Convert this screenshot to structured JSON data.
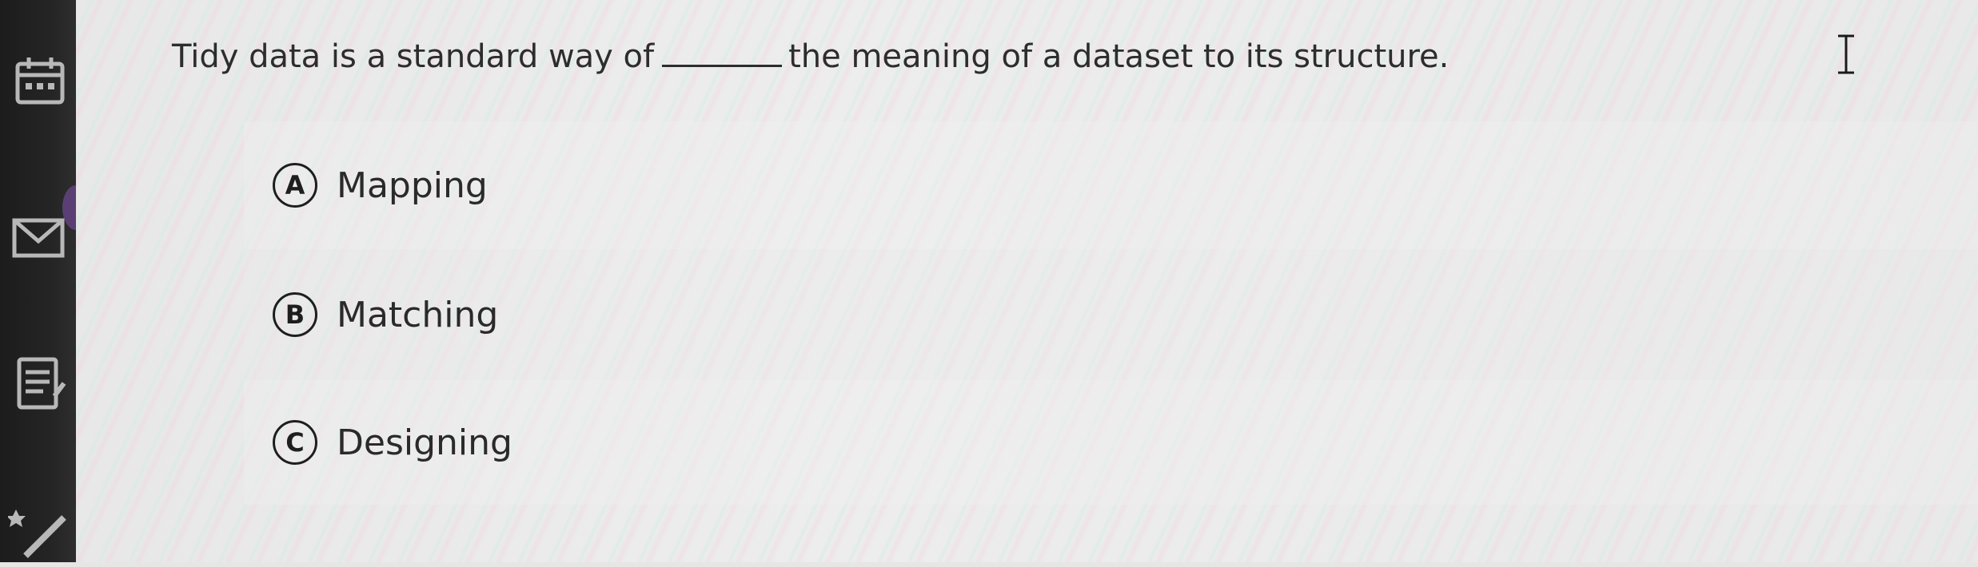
{
  "sidebar": {
    "icons": [
      "calendar-icon",
      "mail-icon",
      "notes-icon",
      "edit-icon"
    ]
  },
  "question": {
    "before_blank": "Tidy data is a standard way of",
    "after_blank": "the meaning of a dataset to its structure."
  },
  "options": [
    {
      "letter": "A",
      "label": "Mapping"
    },
    {
      "letter": "B",
      "label": "Matching"
    },
    {
      "letter": "C",
      "label": "Designing"
    }
  ]
}
